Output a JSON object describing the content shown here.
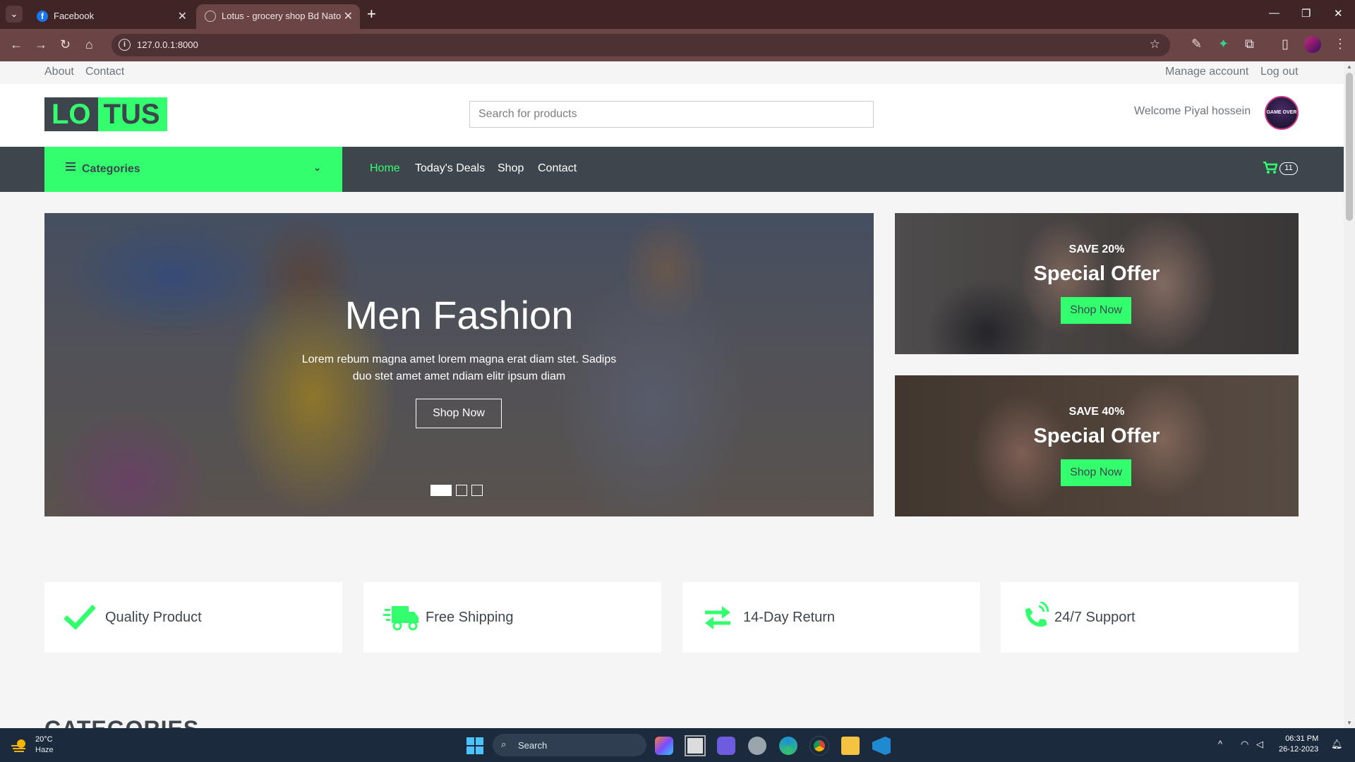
{
  "browser": {
    "tabs": [
      {
        "title": "Facebook",
        "active": false,
        "favicon": "facebook-icon"
      },
      {
        "title": "Lotus - grocery shop Bd Natore",
        "active": true,
        "favicon": "globe-icon"
      }
    ],
    "url": "127.0.0.1:8000"
  },
  "topbar": {
    "left_links": [
      "About",
      "Contact"
    ],
    "right_links": [
      "Manage account",
      "Log out"
    ]
  },
  "header": {
    "logo_part1": "LO",
    "logo_part2": "TUS",
    "search_placeholder": "Search for products",
    "welcome": "Welcome Piyal hossein",
    "avatar_text": "GAME OVER"
  },
  "navbar": {
    "categories_label": "Categories",
    "links": [
      "Home",
      "Today's Deals",
      "Shop",
      "Contact"
    ],
    "active_link": "Home",
    "cart_count": "11"
  },
  "carousel": {
    "title": "Men Fashion",
    "text": "Lorem rebum magna amet lorem magna erat diam stet. Sadips duo stet amet amet ndiam elitr ipsum diam",
    "button": "Shop Now",
    "slides": 3,
    "active_slide": 1
  },
  "offers": [
    {
      "save": "SAVE 20%",
      "title": "Special Offer",
      "button": "Shop Now"
    },
    {
      "save": "SAVE 40%",
      "title": "Special Offer",
      "button": "Shop Now"
    }
  ],
  "features": [
    {
      "label": "Quality Product",
      "icon": "check-icon"
    },
    {
      "label": "Free Shipping",
      "icon": "truck-icon"
    },
    {
      "label": "14-Day Return",
      "icon": "exchange-icon"
    },
    {
      "label": "24/7 Support",
      "icon": "phone-volume-icon"
    }
  ],
  "section_title": "CATEGORIES",
  "colors": {
    "accent": "#33ff6e",
    "dark": "#3d464d"
  },
  "taskbar": {
    "weather_temp": "20°C",
    "weather_desc": "Haze",
    "search_label": "Search",
    "time": "06:31 PM",
    "date": "26-12-2023"
  }
}
